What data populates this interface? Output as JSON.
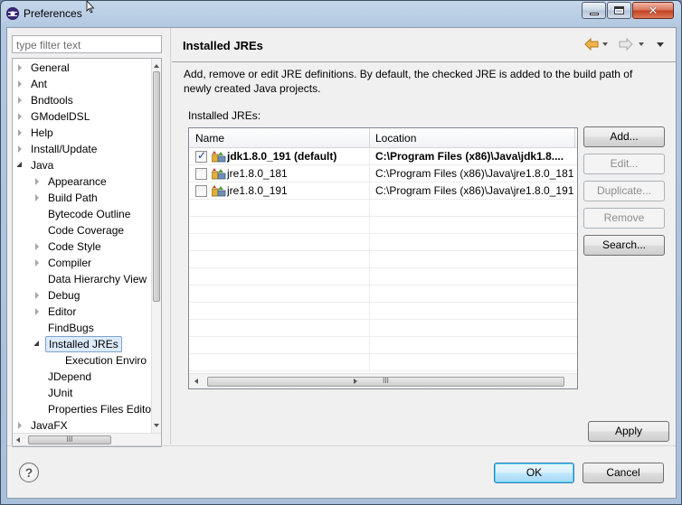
{
  "window": {
    "title": "Preferences"
  },
  "filter": {
    "placeholder": "type filter text"
  },
  "tree": {
    "items": [
      {
        "label": "General",
        "level": 0,
        "state": "collapsed"
      },
      {
        "label": "Ant",
        "level": 0,
        "state": "collapsed"
      },
      {
        "label": "Bndtools",
        "level": 0,
        "state": "collapsed"
      },
      {
        "label": "GModelDSL",
        "level": 0,
        "state": "collapsed"
      },
      {
        "label": "Help",
        "level": 0,
        "state": "collapsed"
      },
      {
        "label": "Install/Update",
        "level": 0,
        "state": "collapsed"
      },
      {
        "label": "Java",
        "level": 0,
        "state": "expanded"
      },
      {
        "label": "Appearance",
        "level": 1,
        "state": "collapsed"
      },
      {
        "label": "Build Path",
        "level": 1,
        "state": "collapsed"
      },
      {
        "label": "Bytecode Outline",
        "level": 1,
        "state": "leaf"
      },
      {
        "label": "Code Coverage",
        "level": 1,
        "state": "leaf"
      },
      {
        "label": "Code Style",
        "level": 1,
        "state": "collapsed"
      },
      {
        "label": "Compiler",
        "level": 1,
        "state": "collapsed"
      },
      {
        "label": "Data Hierarchy View",
        "level": 1,
        "state": "leaf"
      },
      {
        "label": "Debug",
        "level": 1,
        "state": "collapsed"
      },
      {
        "label": "Editor",
        "level": 1,
        "state": "collapsed"
      },
      {
        "label": "FindBugs",
        "level": 1,
        "state": "leaf"
      },
      {
        "label": "Installed JREs",
        "level": 1,
        "state": "expanded",
        "selected": true
      },
      {
        "label": "Execution Enviro",
        "level": 2,
        "state": "leaf"
      },
      {
        "label": "JDepend",
        "level": 1,
        "state": "leaf"
      },
      {
        "label": "JUnit",
        "level": 1,
        "state": "leaf"
      },
      {
        "label": "Properties Files Edito",
        "level": 1,
        "state": "leaf"
      },
      {
        "label": "JavaFX",
        "level": 0,
        "state": "collapsed"
      }
    ]
  },
  "page": {
    "title": "Installed JREs",
    "description": "Add, remove or edit JRE definitions. By default, the checked JRE is added to the build path of newly created Java projects.",
    "group_label": "Installed JREs:"
  },
  "table": {
    "columns": [
      "Name",
      "Location"
    ],
    "rows": [
      {
        "name": "jdk1.8.0_191 (default)",
        "location": "C:\\Program Files (x86)\\Java\\jdk1.8....",
        "checked": true,
        "bold": true
      },
      {
        "name": "jre1.8.0_181",
        "location": "C:\\Program Files (x86)\\Java\\jre1.8.0_181",
        "checked": false,
        "bold": false
      },
      {
        "name": "jre1.8.0_191",
        "location": "C:\\Program Files (x86)\\Java\\jre1.8.0_191",
        "checked": false,
        "bold": false
      }
    ]
  },
  "buttons": {
    "add": "Add...",
    "edit": "Edit...",
    "duplicate": "Duplicate...",
    "remove": "Remove",
    "search": "Search...",
    "apply": "Apply",
    "ok": "OK",
    "cancel": "Cancel",
    "help": "?"
  },
  "scroll_grip": "III",
  "colors": {
    "selection": "#dcebfc",
    "default_button": "#a7d9f5",
    "back_arrow": "#f0b44c"
  },
  "icons": [
    "preferences-icon",
    "back-arrow-icon",
    "forward-arrow-icon",
    "view-menu-icon",
    "jre-icon",
    "help-icon"
  ]
}
